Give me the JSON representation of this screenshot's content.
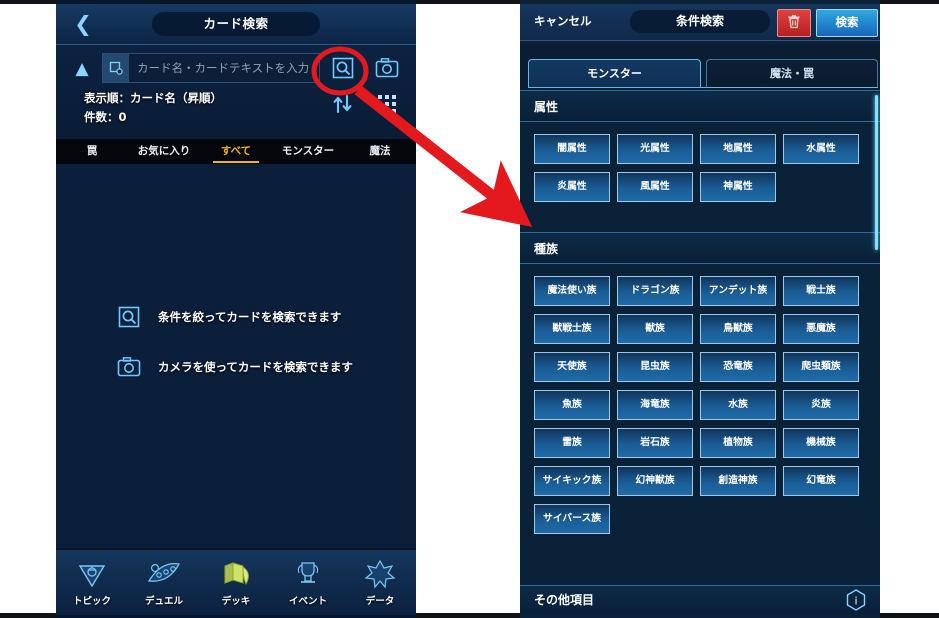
{
  "annotation": {
    "highlight_color": "#e3191e",
    "circle_target": "search-icon",
    "arrow_points_to": "right-phone-panel"
  },
  "left_phone": {
    "titlebar": {
      "back_icon": "chevron-left-icon",
      "title": "カード検索"
    },
    "search": {
      "collapse_icon": "chevron-up-icon",
      "field_icon": "card-text-icon",
      "placeholder": "カード名・カードテキストを入力",
      "value": "",
      "search_icon": "search-icon",
      "camera_icon": "camera-icon",
      "sort_icon": "sort-updown-icon",
      "grid_icon": "grid-view-icon",
      "sort_label": "表示順：カード名（昇順）",
      "count_label": "件数：0"
    },
    "tabs": [
      {
        "label": "罠",
        "active": false
      },
      {
        "label": "お気に入り",
        "active": false
      },
      {
        "label": "すべて",
        "active": true
      },
      {
        "label": "モンスター",
        "active": false
      },
      {
        "label": "魔法",
        "active": false
      }
    ],
    "hints": [
      {
        "icon": "search-filter-icon",
        "text": "条件を絞ってカードを検索できます"
      },
      {
        "icon": "camera-icon",
        "text": "カメラを使ってカードを検索できます"
      }
    ],
    "bottom_nav": [
      {
        "icon": "topic-icon",
        "label": "トピック",
        "active": false
      },
      {
        "icon": "duel-icon",
        "label": "デュエル",
        "active": false
      },
      {
        "icon": "deck-icon",
        "label": "デッキ",
        "active": true
      },
      {
        "icon": "event-trophy-icon",
        "label": "イベント",
        "active": false
      },
      {
        "icon": "data-icon",
        "label": "データ",
        "active": false
      }
    ]
  },
  "right_phone": {
    "titlebar": {
      "cancel_label": "キャンセル",
      "title": "条件検索",
      "trash_icon": "trash-icon",
      "search_label": "検索",
      "trash_color": "#c92a2a",
      "search_color": "#1d7fc9"
    },
    "tabs": [
      {
        "label": "モンスター",
        "active": true
      },
      {
        "label": "魔法・罠",
        "active": false
      }
    ],
    "sections": [
      {
        "title": "属性",
        "options": [
          "闇属性",
          "光属性",
          "地属性",
          "水属性",
          "炎属性",
          "風属性",
          "神属性"
        ]
      },
      {
        "title": "種族",
        "options": [
          "魔法使い族",
          "ドラゴン族",
          "アンデット族",
          "戦士族",
          "獣戦士族",
          "獣族",
          "鳥獣族",
          "悪魔族",
          "天使族",
          "昆虫族",
          "恐竜族",
          "爬虫類族",
          "魚族",
          "海竜族",
          "水族",
          "炎族",
          "雷族",
          "岩石族",
          "植物族",
          "機械族",
          "サイキック族",
          "幻神獣族",
          "創造神族",
          "幻竜族",
          "サイバース族"
        ]
      }
    ],
    "footer": {
      "label": "その他項目",
      "info_icon": "info-icon"
    }
  }
}
